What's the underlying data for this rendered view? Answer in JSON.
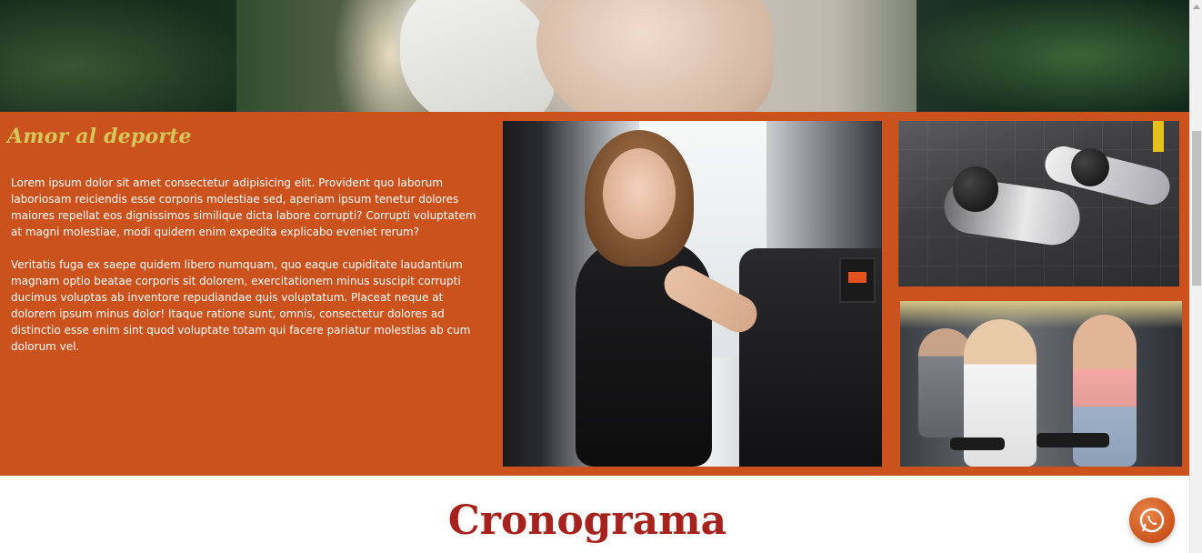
{
  "hero": {
    "image": "woman-training-photo"
  },
  "feature": {
    "title": "Amor al deporte",
    "paragraphs": [
      "Lorem ipsum dolor sit amet consectetur adipisicing elit. Provident quo laborum laboriosam reiciendis esse corporis molestiae sed, aperiam ipsum tenetur dolores maiores repellat eos dignissimos similique dicta labore corrupti? Corrupti voluptatem at magni molestiae, modi quidem enim expedita explicabo eveniet rerum?",
      "Veritatis fuga ex saepe quidem libero numquam, quo eaque cupiditate laudantium magnam optio beatae corporis sit dolorem, exercitationem minus suscipit corrupti ducimus voluptas ab inventore repudiandae quis voluptatum. Placeat neque at dolorem ipsum minus dolor! Itaque ratione sunt, omnis, consectetur dolores ad distinctio esse enim sint quod voluptate totam qui facere pariatur molestias ab cum dolorum vel."
    ],
    "images": [
      "woman-elliptical-photo",
      "medicine-ball-situps-photo",
      "dumbbell-class-photo"
    ],
    "colors": {
      "background": "#cb521c",
      "title": "#d7c65a",
      "text": "#ffffff"
    }
  },
  "section": {
    "title": "Cronograma",
    "color": "#a5231c"
  },
  "floating_button": {
    "icon": "whatsapp-icon",
    "color": "#c85018"
  }
}
